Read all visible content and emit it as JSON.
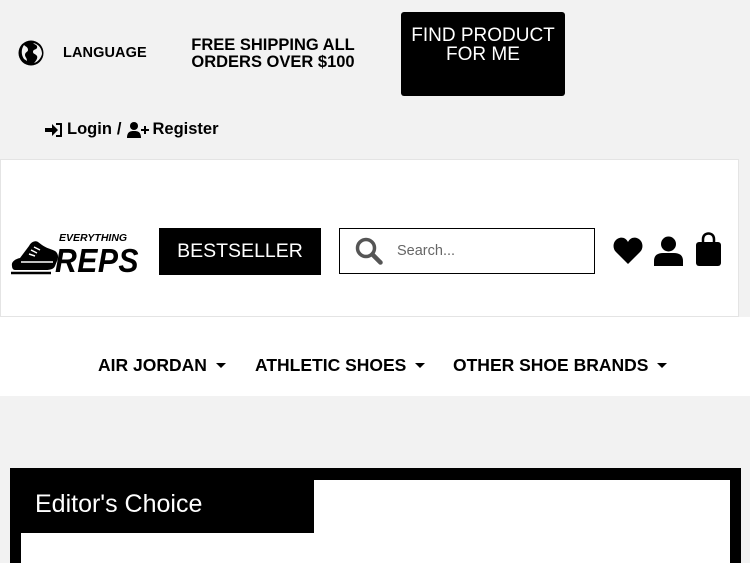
{
  "topbar": {
    "language_label": "LANGUAGE",
    "shipping_text": "FREE SHIPPING ALL ORDERS OVER $100",
    "find_product_label": "FIND PRODUCT FOR ME",
    "login_label": "Login",
    "separator": "/",
    "register_label": "Register"
  },
  "header": {
    "logo_top_text": "EVERYTHING",
    "logo_main_text": "REPS",
    "bestseller_label": "BESTSELLER",
    "search_placeholder": "Search..."
  },
  "nav": {
    "items": [
      {
        "label": "AIR JORDAN"
      },
      {
        "label": "ATHLETIC SHOES"
      },
      {
        "label": "OTHER SHOE BRANDS"
      }
    ]
  },
  "section": {
    "title": "Editor's Choice"
  },
  "colors": {
    "primary": "#000000",
    "background": "#f2f2f2",
    "surface": "#ffffff"
  }
}
